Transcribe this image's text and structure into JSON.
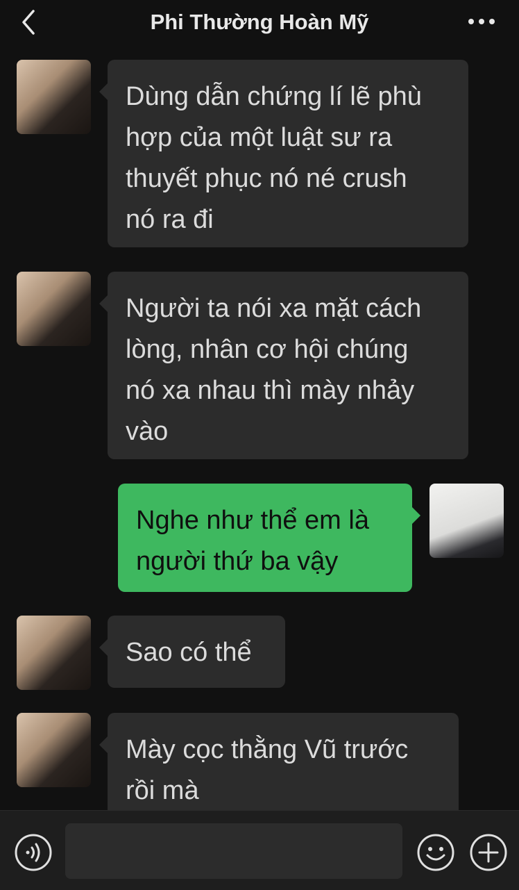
{
  "header": {
    "back_icon": "chevron-left-icon",
    "title": "Phi Thường Hoàn Mỹ",
    "more_icon": "more-dots-icon"
  },
  "messages": [
    {
      "sender": "friend",
      "text": "Dùng dẫn chứng lí lẽ phù\nhợp của một luật sư ra\nthuyết phục nó né crush\nnó ra đi"
    },
    {
      "sender": "friend",
      "text": "Người ta nói xa mặt cách\nlòng, nhân cơ hội chúng\nnó xa nhau thì mày nhảy\nvào"
    },
    {
      "sender": "me",
      "text": "Nghe như thể em là\nngười thứ ba vậy"
    },
    {
      "sender": "friend",
      "text": "Sao có thể"
    },
    {
      "sender": "friend",
      "text": "Mày cọc thằng Vũ trước\nrồi mà"
    }
  ],
  "input_bar": {
    "voice_icon": "voice-icon",
    "input_value": "",
    "emoji_icon": "emoji-icon",
    "plus_icon": "plus-icon"
  },
  "colors": {
    "background": "#111111",
    "incoming_bubble": "#2c2c2c",
    "outgoing_bubble": "#3eb85f"
  }
}
